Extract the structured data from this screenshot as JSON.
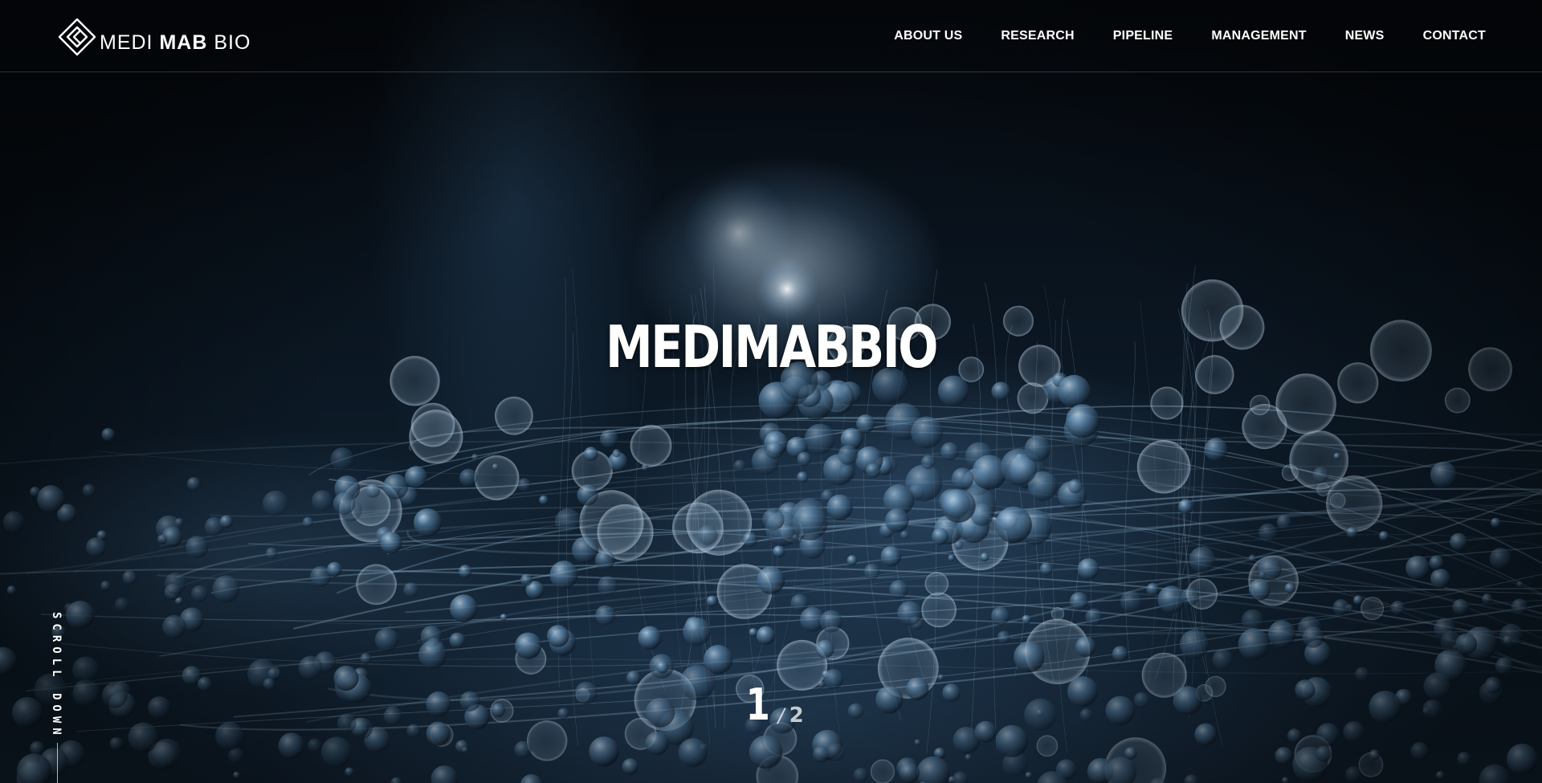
{
  "brand": {
    "logo_light_1": "MEDI",
    "logo_bold": "MAB",
    "logo_light_2": "BIO",
    "logo_icon": "medimabbio-logo-icon"
  },
  "nav": {
    "items": [
      {
        "label": "ABOUT US"
      },
      {
        "label": "RESEARCH"
      },
      {
        "label": "PIPELINE"
      },
      {
        "label": "MANAGEMENT"
      },
      {
        "label": "NEWS"
      },
      {
        "label": "CONTACT"
      }
    ]
  },
  "hero": {
    "title": "MEDIMABBIO"
  },
  "scroll": {
    "label": "SCROLL DOWN"
  },
  "pager": {
    "current": "1",
    "separator": "/",
    "total": "2"
  },
  "colors": {
    "background": "#05080d",
    "accent_blue": "#4a7aa3",
    "text": "#ffffff"
  }
}
